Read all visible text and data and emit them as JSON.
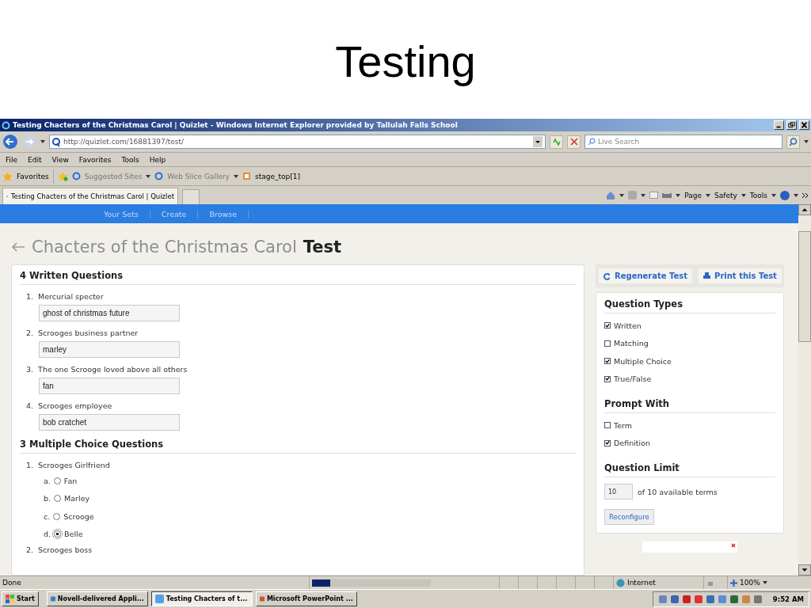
{
  "slide": {
    "title": "Testing"
  },
  "window": {
    "title": "Testing Chacters of the Christmas Carol | Quizlet - Windows Internet Explorer provided by Tallulah Falls School"
  },
  "address_bar": {
    "url": "http://quizlet.com/16881397/test/"
  },
  "search": {
    "placeholder": "Live Search"
  },
  "menu": [
    "File",
    "Edit",
    "View",
    "Favorites",
    "Tools",
    "Help"
  ],
  "favorites_bar": {
    "label": "Favorites",
    "items": [
      {
        "label": "Suggested Sites",
        "kind": "dropdown"
      },
      {
        "label": "Web Slice Gallery",
        "kind": "dropdown"
      },
      {
        "label": "stage_top[1]",
        "kind": "link"
      }
    ]
  },
  "tab": {
    "title": "Testing Chacters of the Christmas Carol | Quizlet"
  },
  "command_bar": [
    "Page",
    "Safety",
    "Tools"
  ],
  "site_nav": [
    "Your Sets",
    "Create",
    "Browse"
  ],
  "page": {
    "set_title": "Chacters of the Christmas Carol",
    "mode": "Test"
  },
  "written": {
    "heading": "4 Written Questions",
    "questions": [
      {
        "number": "1.",
        "prompt": "Mercurial specter",
        "answer": "ghost of christmas future"
      },
      {
        "number": "2.",
        "prompt": "Scrooges business partner",
        "answer": "marley"
      },
      {
        "number": "3.",
        "prompt": "The one Scrooge loved above all others",
        "answer": "fan"
      },
      {
        "number": "4.",
        "prompt": "Scrooges employee",
        "answer": "bob cratchet"
      }
    ]
  },
  "multiple_choice": {
    "heading": "3 Multiple Choice Questions",
    "questions": [
      {
        "number": "1.",
        "prompt": "Scrooges Girlfriend",
        "options": [
          {
            "letter": "a.",
            "label": "Fan",
            "selected": false
          },
          {
            "letter": "b.",
            "label": "Marley",
            "selected": false
          },
          {
            "letter": "c.",
            "label": "Scrooge",
            "selected": false
          },
          {
            "letter": "d.",
            "label": "Belle",
            "selected": true
          }
        ]
      },
      {
        "number": "2.",
        "prompt": "Scrooges boss"
      }
    ]
  },
  "actions": [
    {
      "label": "Regenerate Test",
      "kind": "regenerate"
    },
    {
      "label": "Print this Test",
      "kind": "print"
    }
  ],
  "question_types": {
    "heading": "Question Types",
    "options": [
      {
        "label": "Written",
        "checked": true
      },
      {
        "label": "Matching",
        "checked": false
      },
      {
        "label": "Multiple Choice",
        "checked": true
      },
      {
        "label": "True/False",
        "checked": true
      }
    ]
  },
  "prompt_with": {
    "heading": "Prompt With",
    "options": [
      {
        "label": "Term",
        "checked": false
      },
      {
        "label": "Definition",
        "checked": true
      }
    ]
  },
  "question_limit": {
    "heading": "Question Limit",
    "value": "10",
    "suffix": "of 10 available terms",
    "button": "Reconfigure"
  },
  "status_bar": {
    "text": "Done",
    "progress": {
      "level": 0.15
    },
    "zone": "Internet",
    "zoom": "100%"
  },
  "taskbar": {
    "start": "Start",
    "tasks": [
      {
        "label": "Novell-delivered Appli...",
        "selected": false
      },
      {
        "label": "Testing Chacters of t...",
        "selected": true
      },
      {
        "label": "Microsoft PowerPoint ...",
        "selected": false
      }
    ],
    "clock": "9:52 AM"
  }
}
